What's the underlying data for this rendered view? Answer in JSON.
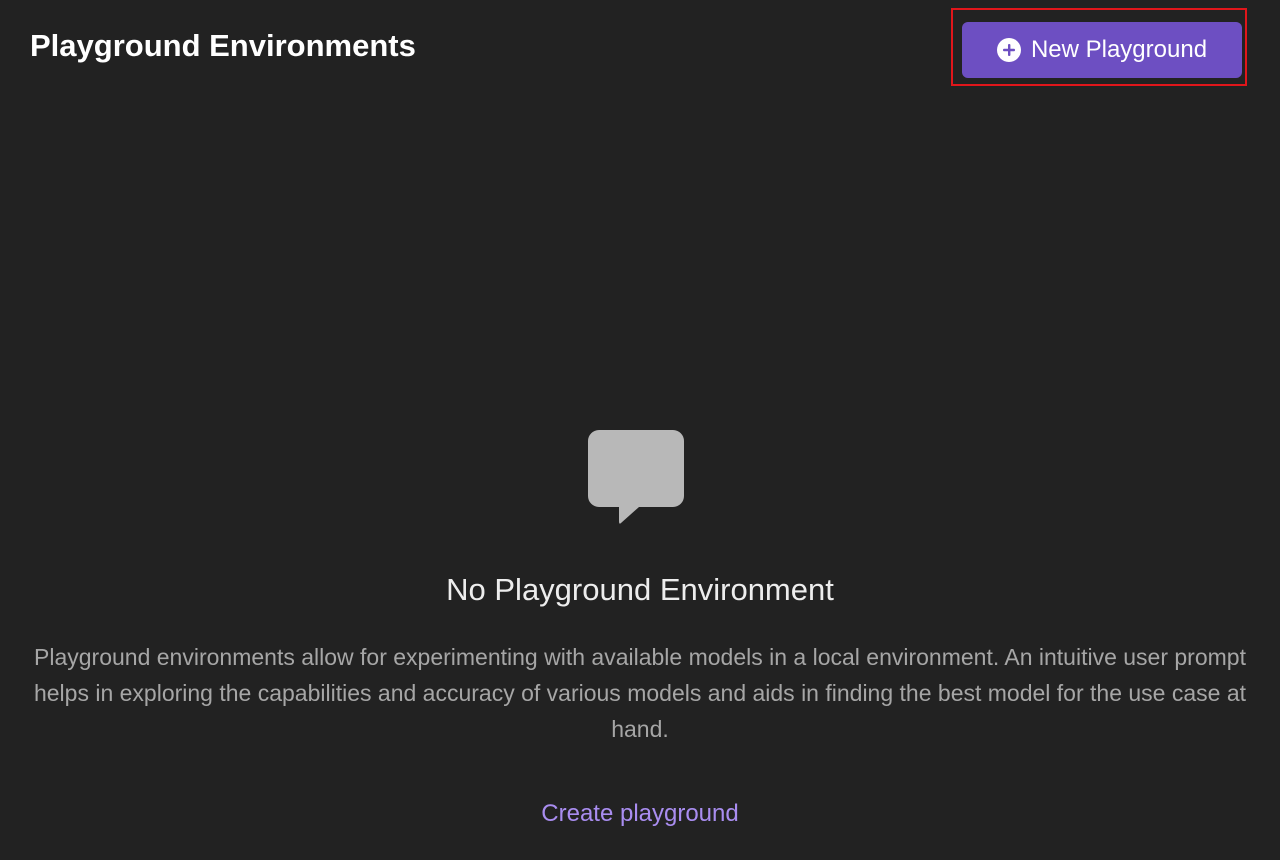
{
  "header": {
    "title": "Playground Environments",
    "new_button_label": "New Playground",
    "new_button_icon": "plus-circle-icon"
  },
  "empty_state": {
    "icon": "chat-bubble-icon",
    "title": "No Playground Environment",
    "description": "Playground environments allow for experimenting with available models in a local environment. An intuitive user prompt helps in exploring the capabilities and accuracy of various models and aids in finding the best model for the use case at hand.",
    "link_label": "Create playground"
  },
  "colors": {
    "background": "#222222",
    "primary_button": "#6d4fc2",
    "link": "#a98df0",
    "highlight": "#e0161b",
    "icon": "#b8b8b8"
  }
}
